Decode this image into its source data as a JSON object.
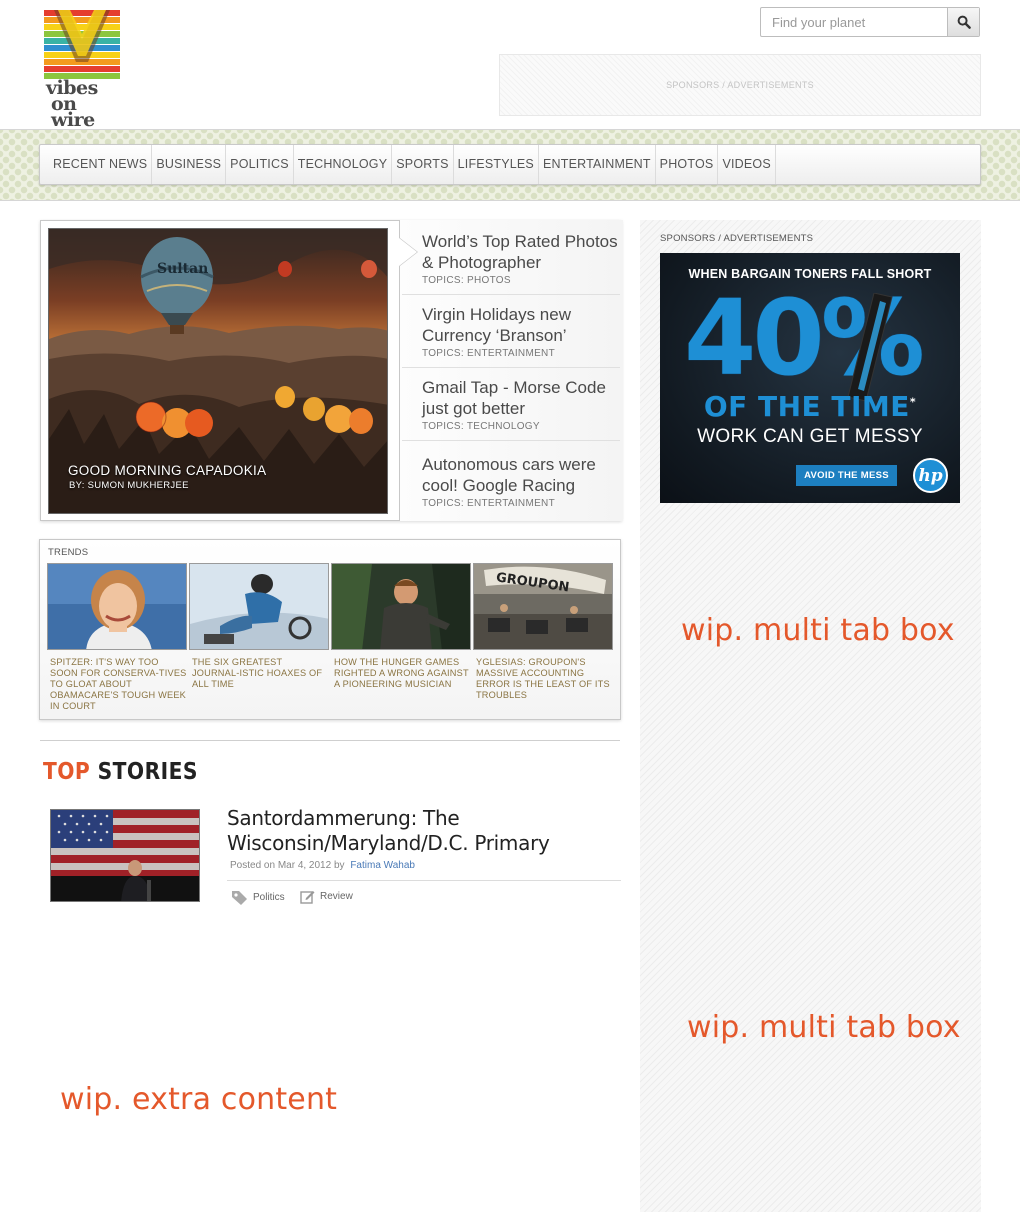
{
  "header": {
    "logo_line1": "vibes",
    "logo_line2": "on wire",
    "search": {
      "placeholder": "Find your planet"
    },
    "top_ad_label": "SPONSORS / ADVERTISEMENTS"
  },
  "nav": {
    "items": [
      "RECENT NEWS",
      "BUSINESS",
      "POLITICS",
      "TECHNOLOGY",
      "SPORTS",
      "LIFESTYLES",
      "ENTERTAINMENT",
      "PHOTOS",
      "VIDEOS"
    ]
  },
  "featured": {
    "photo_title": "GOOD MORNING CAPADOKIA",
    "photo_byline": "BY: SUMON MUKHERJEE",
    "stories": [
      {
        "title": "World’s Top Rated Photos & Photographer",
        "topic": "TOPICS: PHOTOS"
      },
      {
        "title": "Virgin Holidays new Currency ‘Branson’",
        "topic": "TOPICS: ENTERTAINMENT"
      },
      {
        "title": "Gmail Tap - Morse Code just got better",
        "topic": "TOPICS: TECHNOLOGY"
      },
      {
        "title": "Autonomous cars were cool! Google Racing",
        "topic": "TOPICS: ENTERTAINMENT"
      }
    ]
  },
  "trends": {
    "label": "TRENDS",
    "items": [
      {
        "text": "SPITZER: IT'S WAY TOO SOON FOR CONSERVA-TIVES TO GLOAT ABOUT OBAMACARE'S TOUGH WEEK IN COURT"
      },
      {
        "text": "THE SIX GREATEST JOURNAL-ISTIC HOAXES OF ALL TIME"
      },
      {
        "text": "HOW THE HUNGER GAMES RIGHTED A WRONG AGAINST A PIONEERING MUSICIAN"
      },
      {
        "text": "YGLESIAS: GROUPON'S MASSIVE ACCOUNTING ERROR IS THE LEAST OF ITS TROUBLES",
        "image_sign": "GROUPON"
      }
    ]
  },
  "top_stories": {
    "heading_accent": "TOP",
    "heading_rest": "STORIES",
    "article": {
      "title": "Santordammerung: The Wisconsin/Maryland/D.C. Primary",
      "posted": "Posted on Mar 4, 2012 by",
      "author": "Fatima Wahab",
      "tags": [
        "Politics",
        "Review"
      ]
    }
  },
  "placeholders": {
    "extra_content": "wip. extra content",
    "multi_tab_1": "wip. multi tab box",
    "multi_tab_2": "wip. multi tab box"
  },
  "sidebar": {
    "ad_label": "SPONSORS / ADVERTISEMENTS",
    "ad": {
      "headline": "WHEN BARGAIN TONERS FALL SHORT",
      "big_number": "40%",
      "line2": "OF THE TIME",
      "asterisk": "*",
      "line3": "WORK CAN GET MESSY",
      "button": "AVOID THE MESS",
      "brand": "hp"
    }
  },
  "colors": {
    "accent": "#e4582b",
    "link": "#4a7ab7",
    "trend_text": "#8a7442",
    "hp_blue": "#1e8fd5"
  }
}
